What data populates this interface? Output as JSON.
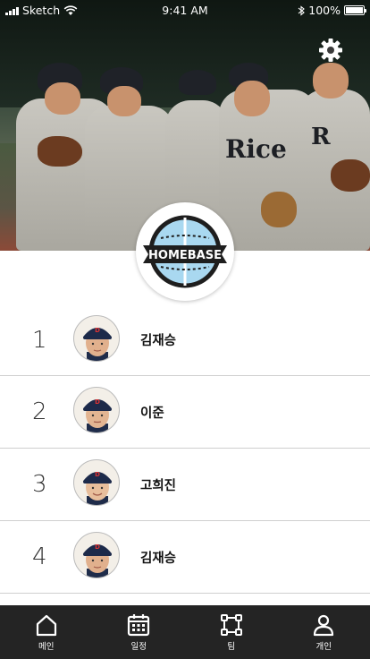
{
  "status_bar": {
    "carrier": "Sketch",
    "time": "9:41 AM",
    "battery": "100%"
  },
  "hero": {
    "logo_text": "HOMEBASE",
    "jersey_text": "Rice",
    "settings_icon": "gear-icon"
  },
  "members": [
    {
      "rank": "1",
      "name": "김재승"
    },
    {
      "rank": "2",
      "name": "이준"
    },
    {
      "rank": "3",
      "name": "고희진"
    },
    {
      "rank": "4",
      "name": "김재승"
    }
  ],
  "tabbar": {
    "items": [
      {
        "label": "메인",
        "icon": "home-icon"
      },
      {
        "label": "일정",
        "icon": "calendar-icon"
      },
      {
        "label": "팀",
        "icon": "team-icon"
      },
      {
        "label": "개인",
        "icon": "person-icon"
      }
    ]
  },
  "colors": {
    "tabbar_bg": "#242424",
    "divider": "#cfcfcf"
  }
}
